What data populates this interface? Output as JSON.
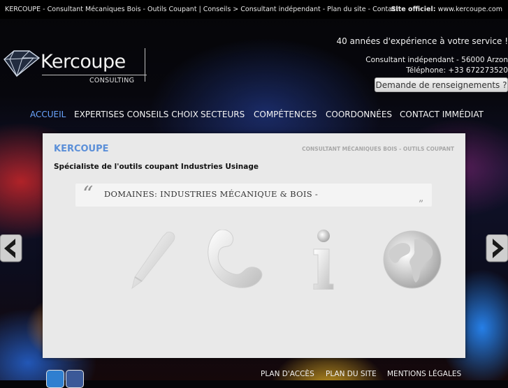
{
  "topbar": {
    "crumbs": "KERCOUPE - Consultant Mécaniques Bois - Outils Coupant | Conseils > Consultant indépendant - Plan du site - Contact",
    "official_label": "Site officiel:",
    "official_url": "www.kercoupe.com"
  },
  "logo": {
    "name": "Kercoupe",
    "sub": "CONSULTING"
  },
  "header": {
    "tagline": "40 années d'expérience à votre service !",
    "address": "Consultant indépendant - 56000 Arzon",
    "phone": "Téléphone: +33 672273520",
    "request_button": "Demande de renseignements ?"
  },
  "nav": {
    "items": [
      "ACCUEIL",
      "EXPERTISES CONSEILS CHOIX",
      "SECTEURS",
      "COMPÉTENCES",
      "COORDONNÉES",
      "CONTACT IMMÉDIAT"
    ],
    "active": "ACCUEIL"
  },
  "content": {
    "title": "KERCOUPE",
    "breadcrumb": "CONSULTANT MÉCANIQUES BOIS - OUTILS COUPANT",
    "heading": "Spécialiste de l'outils coupant Industries Usinage",
    "quote": "DOMAINES: INDUSTRIES MÉCANIQUE & BOIS -",
    "icons": [
      "pen-icon",
      "phone-icon",
      "info-icon",
      "globe-icon"
    ]
  },
  "footer": {
    "links": [
      "PLAN D'ACCÈS",
      "PLAN DU SITE",
      "MENTIONS LÉGALES"
    ],
    "social": [
      "twitter-icon",
      "facebook-icon"
    ]
  },
  "colors": {
    "accent": "#5b8fd8",
    "nav_active": "#6aa5ff",
    "panel": "#e9e9e9"
  }
}
